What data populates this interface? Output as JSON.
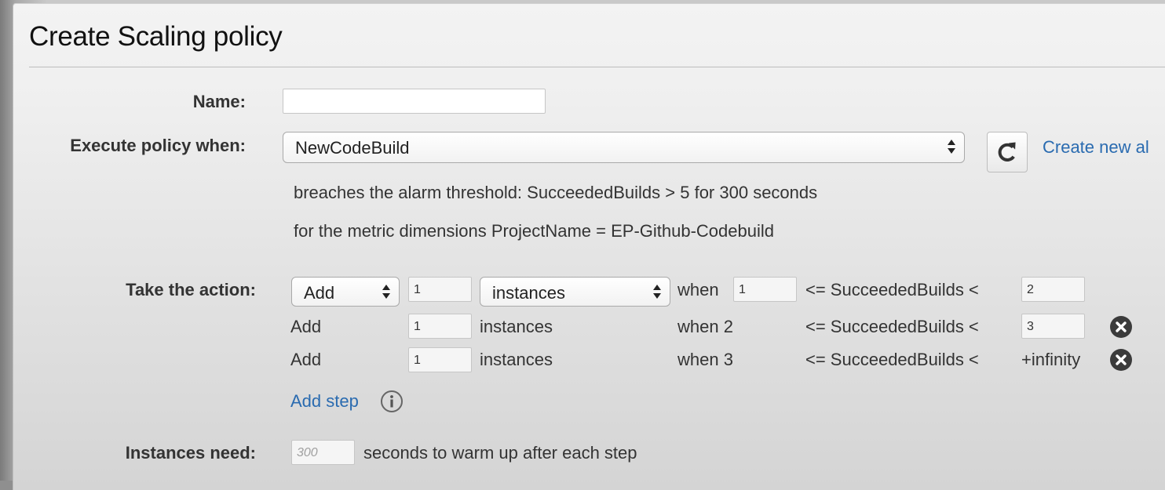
{
  "dialog": {
    "title": "Create Scaling policy"
  },
  "form": {
    "name_label": "Name:",
    "name_value": "",
    "execute_label": "Execute policy when:",
    "alarm_selected": "NewCodeBuild",
    "create_alarm_link": "Create new al",
    "alarm_desc_1": "breaches the alarm threshold: SucceededBuilds > 5 for 300 seconds",
    "alarm_desc_2": "for the metric dimensions ProjectName = EP-Github-Codebuild",
    "action_label": "Take the action:",
    "warmup_label": "Instances need:",
    "warmup_placeholder": "300",
    "warmup_suffix": "seconds to warm up after each step",
    "add_step_link": "Add step"
  },
  "steps": [
    {
      "operation": "Add",
      "amount": "1",
      "unit": "instances",
      "when": "when",
      "lower": "1",
      "metric": "<= SucceededBuilds <",
      "upper": "2"
    },
    {
      "operation": "Add",
      "amount": "1",
      "unit": "instances",
      "when": "when 2",
      "metric": "<= SucceededBuilds <",
      "upper": "3"
    },
    {
      "operation": "Add",
      "amount": "1",
      "unit": "instances",
      "when": "when 3",
      "metric": "<= SucceededBuilds <",
      "upper": "+infinity"
    }
  ],
  "colors": {
    "link": "#2a6bb0",
    "remove_icon": "#3b3b3b"
  }
}
